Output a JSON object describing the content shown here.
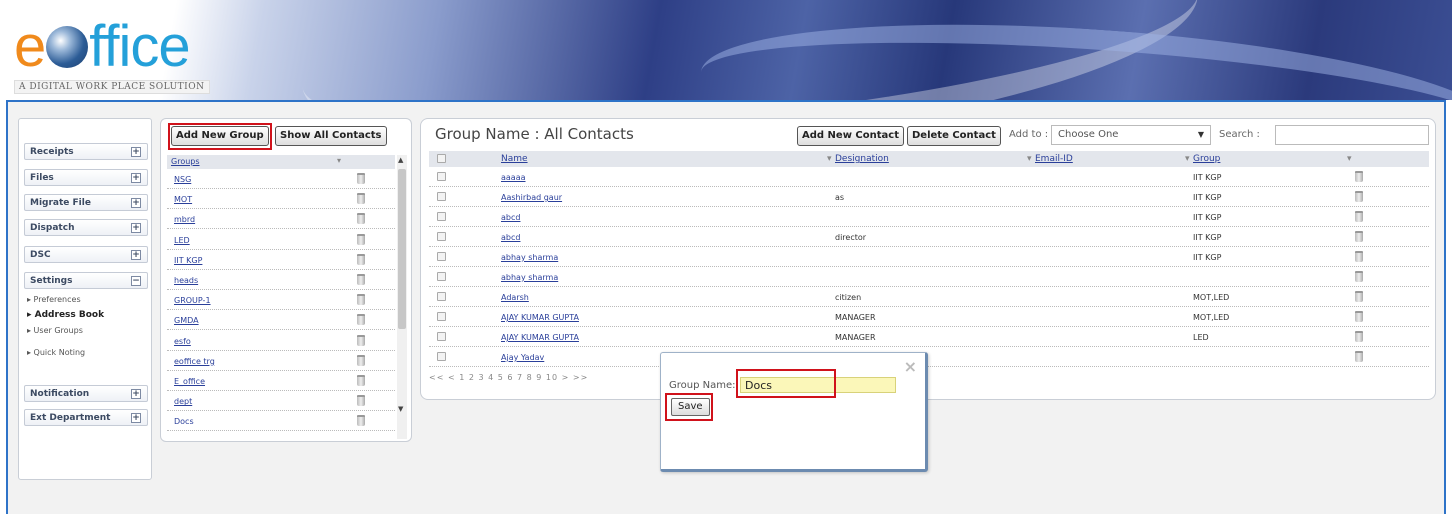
{
  "logo": {
    "prefix": "e",
    "rest": "ffice",
    "tagline": "A DIGITAL WORK PLACE SOLUTION"
  },
  "sidebar": {
    "items": [
      {
        "label": "Receipts",
        "toggle": "+"
      },
      {
        "label": "Files",
        "toggle": "+"
      },
      {
        "label": "Migrate File",
        "toggle": "+"
      },
      {
        "label": "Dispatch",
        "toggle": "+"
      },
      {
        "label": "DSC",
        "toggle": "+"
      },
      {
        "label": "Settings",
        "toggle": "−"
      },
      {
        "label": "Notification",
        "toggle": "+"
      },
      {
        "label": "Ext Department",
        "toggle": "+"
      }
    ],
    "settings_sub": [
      "▸ Preferences",
      "▸ Address Book",
      "▸ User Groups",
      "▸ Quick Noting"
    ]
  },
  "groups_panel": {
    "add_group_label": "Add New Group",
    "show_all_label": "Show All Contacts",
    "header": "Groups",
    "groups": [
      "NSG",
      "MOT",
      "mbrd",
      "LED",
      "IIT KGP",
      "heads",
      "GROUP-1",
      "GMDA",
      "esfo",
      "eoffice trg",
      "E_office",
      "dept",
      "Docs"
    ]
  },
  "contacts_panel": {
    "title": "Group Name : All Contacts",
    "add_contact_label": "Add New Contact",
    "delete_contact_label": "Delete Contact",
    "addto_label": "Add to :",
    "addto_value": "Choose One",
    "search_label": "Search :",
    "search_value": "",
    "columns": {
      "name": "Name",
      "designation": "Designation",
      "email": "Email-ID",
      "group": "Group"
    },
    "rows": [
      {
        "name": "aaaaa",
        "designation": "",
        "email": "",
        "group": "IIT KGP"
      },
      {
        "name": "Aashirbad gaur",
        "designation": "as",
        "email": "",
        "group": "IIT KGP"
      },
      {
        "name": "abcd",
        "designation": "",
        "email": "",
        "group": "IIT KGP"
      },
      {
        "name": "abcd",
        "designation": "director",
        "email": "",
        "group": "IIT KGP"
      },
      {
        "name": "abhay sharma",
        "designation": "",
        "email": "",
        "group": "IIT KGP"
      },
      {
        "name": "abhay sharma",
        "designation": "",
        "email": "",
        "group": ""
      },
      {
        "name": "Adarsh",
        "designation": "citizen",
        "email": "",
        "group": "MOT,LED"
      },
      {
        "name": "AJAY KUMAR GUPTA",
        "designation": "MANAGER",
        "email": "",
        "group": "MOT,LED"
      },
      {
        "name": "AJAY KUMAR GUPTA",
        "designation": "MANAGER",
        "email": "",
        "group": "LED"
      },
      {
        "name": "Ajay Yadav",
        "designation": "",
        "email": "",
        "group": ""
      }
    ],
    "pager": "<< < 1 2 3 4 5 6 7 8 9 10 > >>"
  },
  "dialog": {
    "close_glyph": "×",
    "group_name_label": "Group Name:",
    "group_name_value": "Docs",
    "save_label": "Save"
  }
}
